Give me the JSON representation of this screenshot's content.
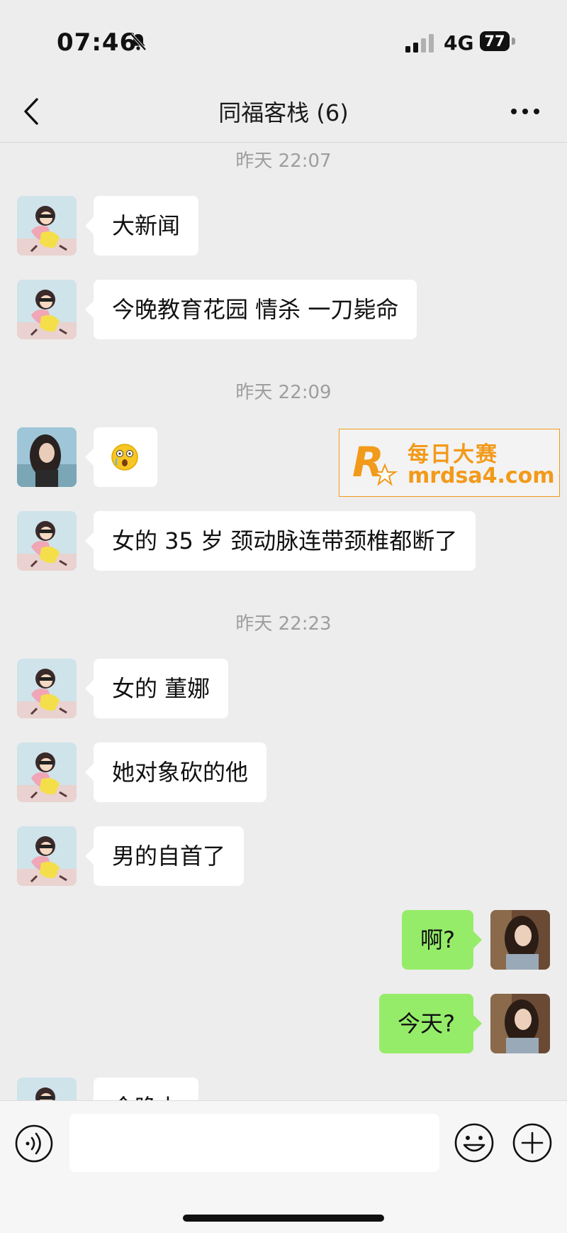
{
  "status_bar": {
    "time": "07:46",
    "network": "4G",
    "battery": "77"
  },
  "nav": {
    "title": "同福客栈 (6)"
  },
  "timestamps": [
    "昨天 22:07",
    "昨天 22:09",
    "昨天 22:23"
  ],
  "messages": [
    {
      "side": "left",
      "avatar": "avatar-cartoon-girl",
      "text": "大新闻"
    },
    {
      "side": "left",
      "avatar": "avatar-cartoon-girl",
      "text": "今晚教育花园 情杀 一刀毙命"
    },
    {
      "side": "left",
      "avatar": "avatar-photo-woman",
      "text": "😲"
    },
    {
      "side": "left",
      "avatar": "avatar-cartoon-girl",
      "text": "女的 35 岁 颈动脉连带颈椎都断了"
    },
    {
      "side": "left",
      "avatar": "avatar-cartoon-girl",
      "text": "女的 董娜"
    },
    {
      "side": "left",
      "avatar": "avatar-cartoon-girl",
      "text": "她对象砍的他"
    },
    {
      "side": "left",
      "avatar": "avatar-cartoon-girl",
      "text": "男的自首了"
    },
    {
      "side": "right",
      "avatar": "avatar-self",
      "text": "啊?"
    },
    {
      "side": "right",
      "avatar": "avatar-self",
      "text": "今天?"
    },
    {
      "side": "left",
      "avatar": "avatar-cartoon-girl",
      "text": "今晚上"
    }
  ],
  "watermark": {
    "title": "每日大赛",
    "url": "mrdsa4.com",
    "color": "#f29a1a"
  },
  "input_bar": {
    "placeholder": ""
  },
  "colors": {
    "background": "#ededed",
    "bubble_self": "#95ec69",
    "bubble_other": "#ffffff"
  }
}
